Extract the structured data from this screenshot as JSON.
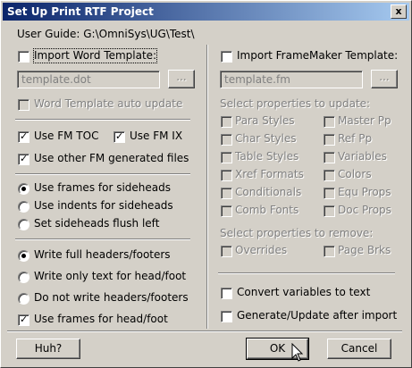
{
  "window": {
    "title": "Set Up Print RTF Project",
    "close": "x"
  },
  "user_guide": "User Guide: G:\\OmniSys\\UG\\Test\\",
  "left": {
    "import_word_template": {
      "label": "Import Word Template:",
      "checked": false
    },
    "word_template_field": "template.dot",
    "browse": "...",
    "word_template_auto_update": {
      "label": "Word Template auto update",
      "checked": false,
      "disabled": true
    },
    "use_fm_toc": {
      "label": "Use FM TOC",
      "checked": true
    },
    "use_fm_ix": {
      "label": "Use FM IX",
      "checked": true
    },
    "use_other_fm": {
      "label": "Use other FM generated files",
      "checked": true
    },
    "sidehead_options": [
      {
        "label": "Use frames for sideheads",
        "selected": true
      },
      {
        "label": "Use indents for sideheads",
        "selected": false
      },
      {
        "label": "Set sideheads flush left",
        "selected": false
      }
    ],
    "header_options": [
      {
        "label": "Write full headers/footers",
        "selected": true
      },
      {
        "label": "Write only text for head/foot",
        "selected": false
      },
      {
        "label": "Do not write headers/footers",
        "selected": false
      }
    ],
    "use_frames_headfoot": {
      "label": "Use frames for head/foot",
      "checked": true
    }
  },
  "right": {
    "import_fm_template": {
      "label": "Import FrameMaker Template:",
      "checked": false
    },
    "fm_template_field": "template.fm",
    "browse": "...",
    "select_update_label": "Select properties to update:",
    "update_props": [
      [
        "Para Styles",
        "Master Pp"
      ],
      [
        "Char Styles",
        "Ref Pp"
      ],
      [
        "Table Styles",
        "Variables"
      ],
      [
        "Xref Formats",
        "Colors"
      ],
      [
        "Conditionals",
        "Equ Props"
      ],
      [
        "Comb Fonts",
        "Doc Props"
      ]
    ],
    "select_remove_label": "Select properties to remove:",
    "remove_props": [
      "Overrides",
      "Page Brks"
    ],
    "convert_variables": {
      "label": "Convert variables to text",
      "checked": false
    },
    "generate_update": {
      "label": "Generate/Update after import",
      "checked": false
    }
  },
  "buttons": {
    "help": "Huh?",
    "ok": "OK",
    "cancel": "Cancel"
  }
}
